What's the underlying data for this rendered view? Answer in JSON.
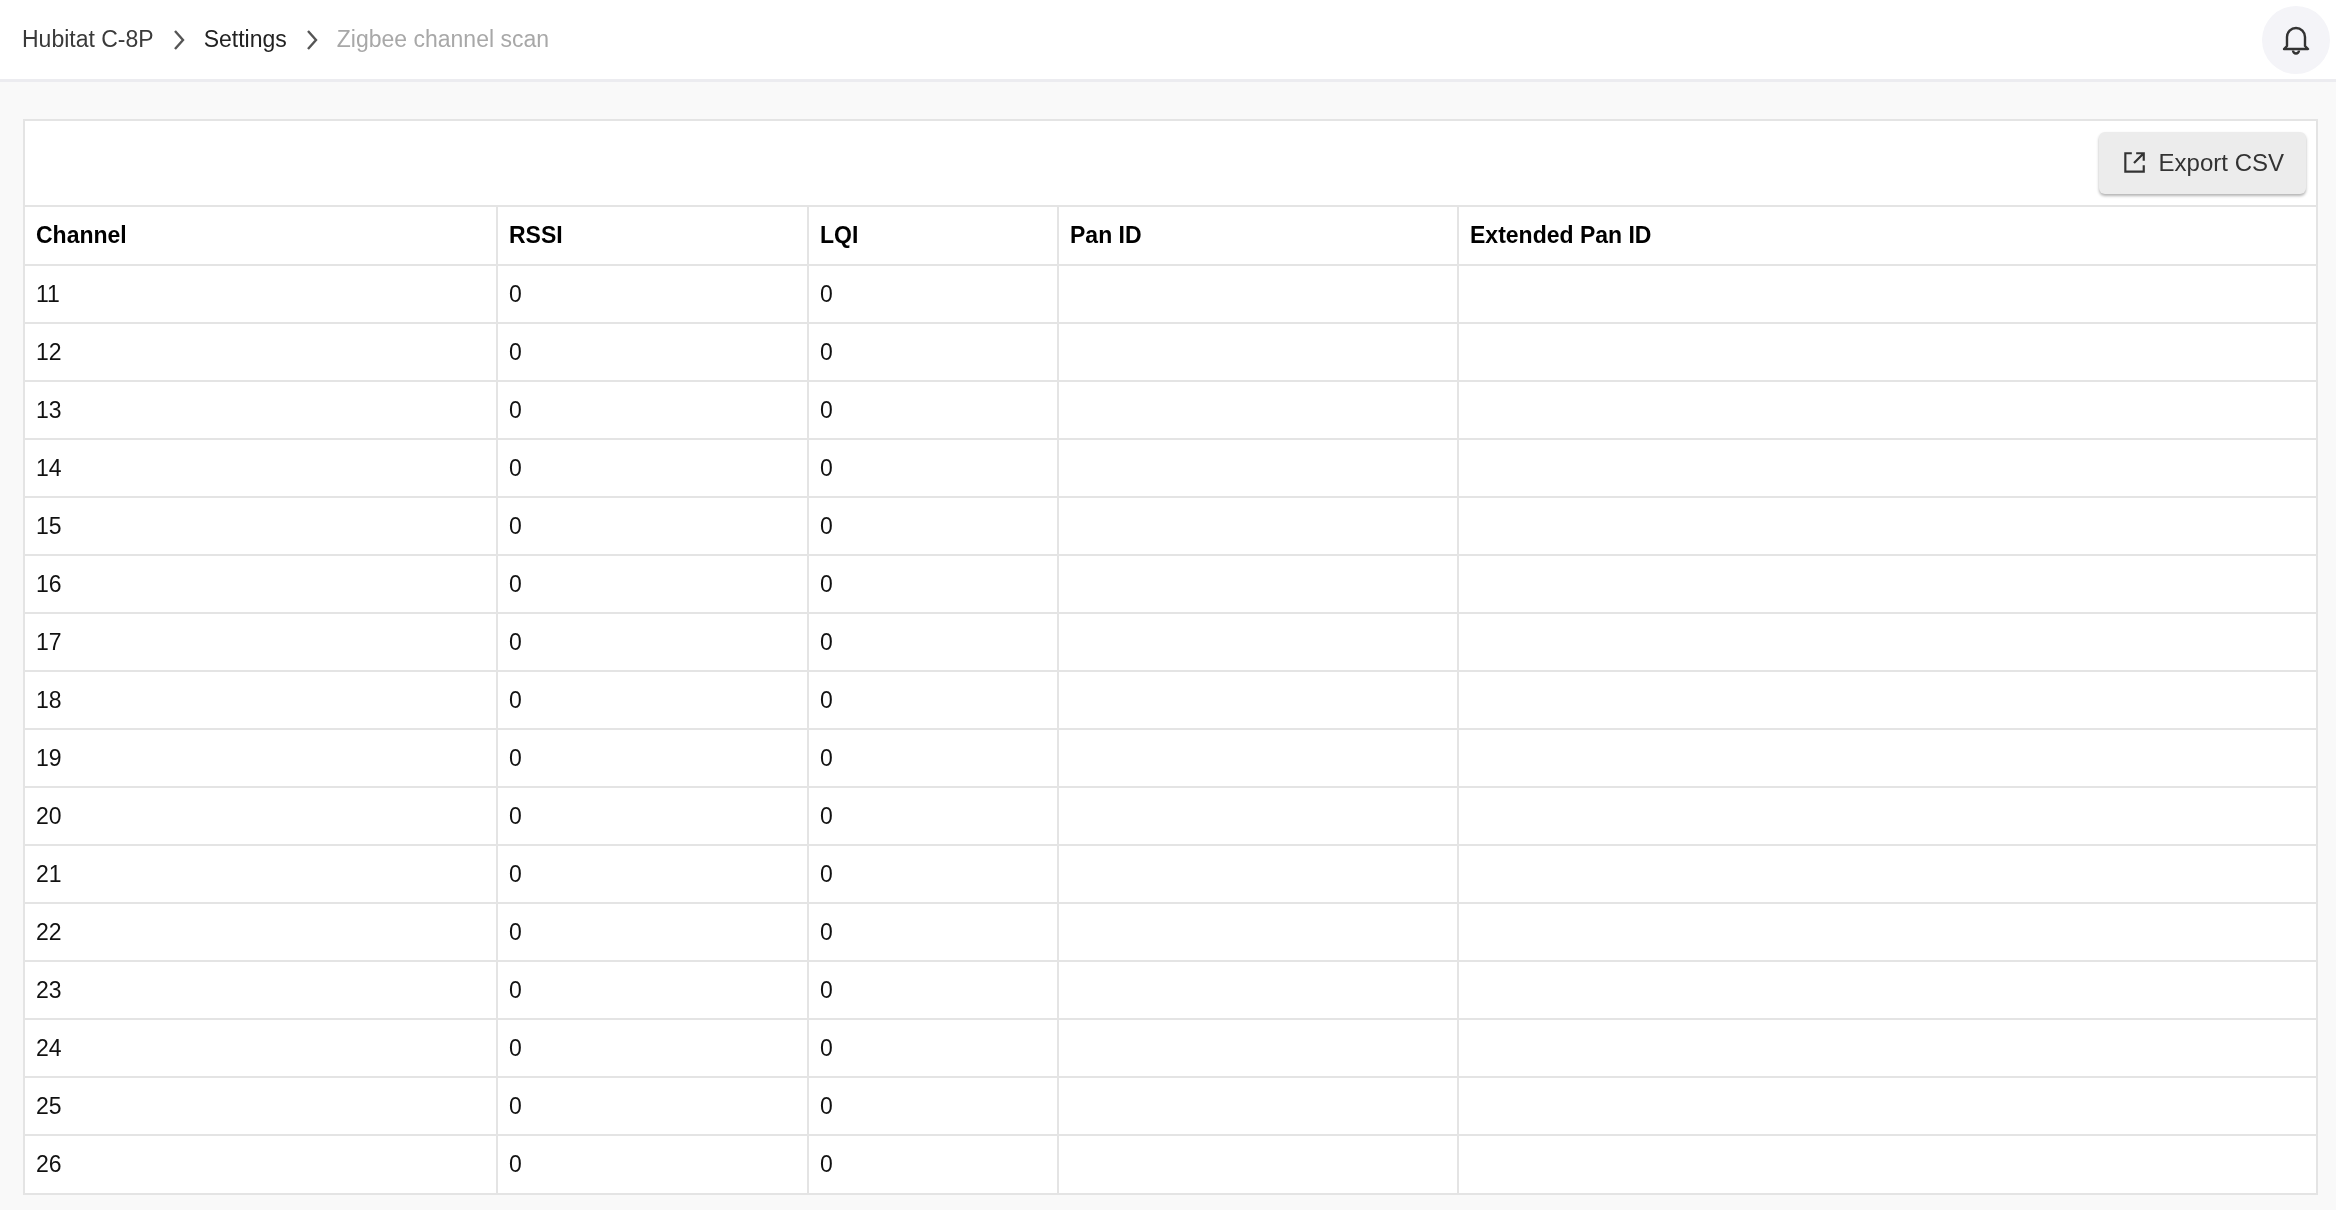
{
  "breadcrumb": [
    {
      "label": "Hubitat C-8P",
      "current": false
    },
    {
      "label": "Settings",
      "current": false
    },
    {
      "label": "Zigbee channel scan",
      "current": true
    }
  ],
  "toolbar": {
    "export_button": "Export CSV"
  },
  "table": {
    "columns": [
      "Channel",
      "RSSI",
      "LQI",
      "Pan ID",
      "Extended Pan ID"
    ],
    "rows": [
      [
        "11",
        "0",
        "0"
      ],
      [
        "12",
        "0",
        "0"
      ],
      [
        "13",
        "0",
        "0"
      ],
      [
        "14",
        "0",
        "0"
      ],
      [
        "15",
        "0",
        "0"
      ],
      [
        "16",
        "0",
        "0"
      ],
      [
        "17",
        "0",
        "0"
      ],
      [
        "18",
        "0",
        "0"
      ],
      [
        "19",
        "0",
        "0"
      ],
      [
        "20",
        "0",
        "0"
      ],
      [
        "21",
        "0",
        "0"
      ],
      [
        "22",
        "0",
        "0"
      ],
      [
        "23",
        "0",
        "0"
      ],
      [
        "24",
        "0",
        "0"
      ],
      [
        "25",
        "0",
        "0"
      ],
      [
        "26",
        "0",
        "0"
      ]
    ]
  }
}
